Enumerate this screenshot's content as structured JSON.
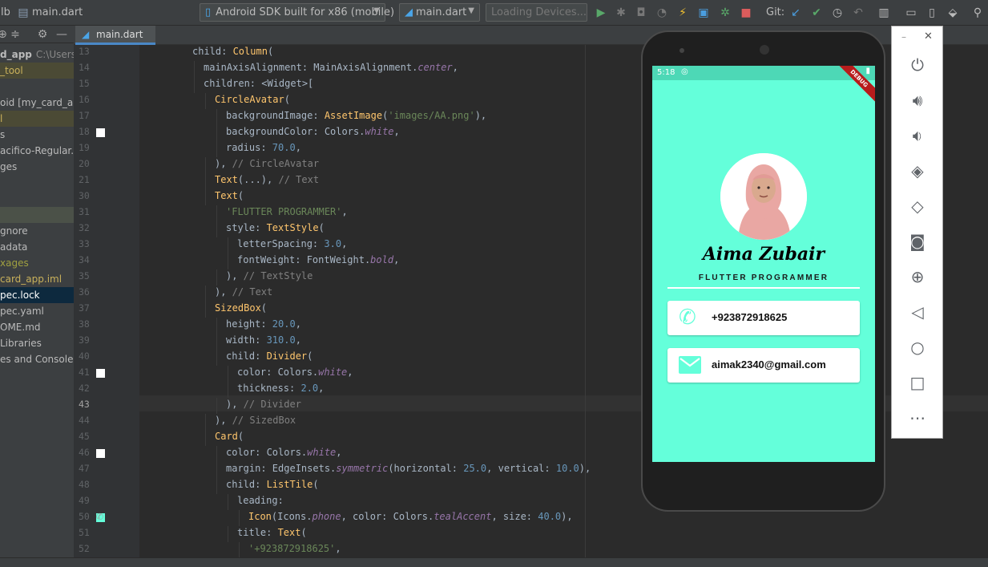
{
  "toolbar": {
    "project_fragment": "lb",
    "file_crumb": "main.dart",
    "device_combo": "Android SDK built for x86 (mobile)",
    "run_config": "main.dart",
    "loading_devices": "Loading Devices...",
    "git_label": "Git:"
  },
  "sidebar": {
    "rows": [
      {
        "label": "d_app",
        "extra": "C:\\Users\\ai"
      },
      {
        "label": "_tool"
      },
      {
        "label": ""
      },
      {
        "label": "oid [my_card_app"
      },
      {
        "label": "l"
      },
      {
        "label": "s"
      },
      {
        "label": "acifico-Regular.tt"
      },
      {
        "label": "ges"
      },
      {
        "label": ""
      },
      {
        "label": ""
      },
      {
        "label": ""
      },
      {
        "label": "gnore"
      },
      {
        "label": "adata"
      },
      {
        "label": "xages"
      },
      {
        "label": "card_app.iml"
      },
      {
        "label": "pec.lock"
      },
      {
        "label": "pec.yaml"
      },
      {
        "label": "OME.md"
      },
      {
        "label": "Libraries"
      },
      {
        "label": "es and Consoles"
      }
    ]
  },
  "editor": {
    "tab_label": "main.dart",
    "lines": [
      {
        "num": "13",
        "code": "child: Column("
      },
      {
        "num": "14",
        "code": "mainAxisAlignment: MainAxisAlignment.center,"
      },
      {
        "num": "15",
        "code": "children: <Widget>["
      },
      {
        "num": "16",
        "code": "CircleAvatar("
      },
      {
        "num": "17",
        "code": "backgroundImage: AssetImage('images/AA.png'),"
      },
      {
        "num": "18",
        "code": "backgroundColor: Colors.white,"
      },
      {
        "num": "19",
        "code": "radius: 70.0,"
      },
      {
        "num": "20",
        "code": "), // CircleAvatar"
      },
      {
        "num": "21",
        "code": "Text(...), // Text"
      },
      {
        "num": "30",
        "code": "Text("
      },
      {
        "num": "31",
        "code": "'FLUTTER PROGRAMMER',"
      },
      {
        "num": "32",
        "code": "style: TextStyle("
      },
      {
        "num": "33",
        "code": "letterSpacing: 3.0,"
      },
      {
        "num": "34",
        "code": "fontWeight: FontWeight.bold,"
      },
      {
        "num": "35",
        "code": "), // TextStyle"
      },
      {
        "num": "36",
        "code": "), // Text"
      },
      {
        "num": "37",
        "code": "SizedBox("
      },
      {
        "num": "38",
        "code": "height: 20.0,"
      },
      {
        "num": "39",
        "code": "width: 310.0,"
      },
      {
        "num": "40",
        "code": "child: Divider("
      },
      {
        "num": "41",
        "code": "color: Colors.white,"
      },
      {
        "num": "42",
        "code": "thickness: 2.0,"
      },
      {
        "num": "43",
        "code": "), // Divider"
      },
      {
        "num": "44",
        "code": "), // SizedBox"
      },
      {
        "num": "45",
        "code": "Card("
      },
      {
        "num": "46",
        "code": "color: Colors.white,"
      },
      {
        "num": "47",
        "code": "margin: EdgeInsets.symmetric(horizontal: 25.0, vertical: 10.0),"
      },
      {
        "num": "48",
        "code": "child: ListTile("
      },
      {
        "num": "49",
        "code": "leading:"
      },
      {
        "num": "50",
        "code": "Icon(Icons.phone, color: Colors.tealAccent, size: 40.0),"
      },
      {
        "num": "51",
        "code": "title: Text("
      },
      {
        "num": "52",
        "code": "'+923872918625',"
      }
    ]
  },
  "phone": {
    "time": "5:18",
    "debug_banner": "DEBUG",
    "name": "Aima Zubair",
    "title": "FLUTTER PROGRAMMER",
    "phone_number": "+923872918625",
    "email": "aimak2340@gmail.com",
    "accent": "#64ffda"
  },
  "emulator_panel": {
    "icons": [
      "power-icon",
      "volume-up-icon",
      "volume-down-icon",
      "rotate-left-icon",
      "rotate-right-icon",
      "camera-icon",
      "zoom-icon",
      "back-icon",
      "home-icon",
      "overview-icon",
      "more-icon"
    ]
  }
}
